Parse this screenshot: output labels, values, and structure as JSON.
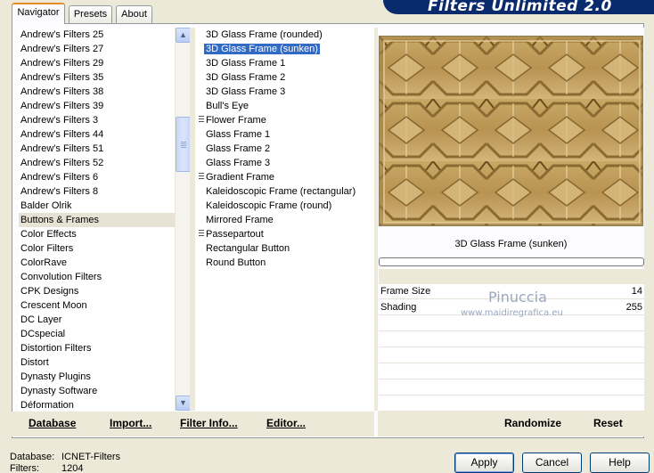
{
  "banner": {
    "title": "Filters Unlimited 2.0"
  },
  "tabs": [
    {
      "label": "Navigator",
      "active": true
    },
    {
      "label": "Presets",
      "active": false
    },
    {
      "label": "About",
      "active": false
    }
  ],
  "categories": [
    "Andrew's Filters 25",
    "Andrew's Filters 27",
    "Andrew's Filters 29",
    "Andrew's Filters 35",
    "Andrew's Filters 38",
    "Andrew's Filters 39",
    "Andrew's Filters 3",
    "Andrew's Filters 44",
    "Andrew's Filters 51",
    "Andrew's Filters 52",
    "Andrew's Filters 6",
    "Andrew's Filters 8",
    "Balder Olrik",
    "Buttons & Frames",
    "Color Effects",
    "Color Filters",
    "ColorRave",
    "Convolution Filters",
    "CPK Designs",
    "Crescent Moon",
    "DC Layer",
    "DCspecial",
    "Distortion Filters",
    "Distort",
    "Dynasty Plugins",
    "Dynasty Software",
    "Déformation"
  ],
  "selected_category": "Buttons & Frames",
  "filters": [
    {
      "label": "3D Glass Frame (rounded)",
      "grip": false
    },
    {
      "label": "3D Glass Frame (sunken)",
      "grip": false
    },
    {
      "label": "3D Glass Frame 1",
      "grip": false
    },
    {
      "label": "3D Glass Frame 2",
      "grip": false
    },
    {
      "label": "3D Glass Frame 3",
      "grip": false
    },
    {
      "label": "Bull's Eye",
      "grip": false
    },
    {
      "label": "Flower Frame",
      "grip": true
    },
    {
      "label": "Glass Frame 1",
      "grip": false
    },
    {
      "label": "Glass Frame 2",
      "grip": false
    },
    {
      "label": "Glass Frame 3",
      "grip": false
    },
    {
      "label": "Gradient Frame",
      "grip": true
    },
    {
      "label": "Kaleidoscopic Frame (rectangular)",
      "grip": false
    },
    {
      "label": "Kaleidoscopic Frame (round)",
      "grip": false
    },
    {
      "label": "Mirrored Frame",
      "grip": false
    },
    {
      "label": "Passepartout",
      "grip": true
    },
    {
      "label": "Rectangular Button",
      "grip": false
    },
    {
      "label": "Round Button",
      "grip": false
    }
  ],
  "selected_filter": "3D Glass Frame (sunken)",
  "preview": {
    "title": "3D Glass Frame (sunken)"
  },
  "params": [
    {
      "name": "Frame Size",
      "value": "14"
    },
    {
      "name": "Shading",
      "value": "255"
    }
  ],
  "watermark": {
    "name": "Pinuccia",
    "site": "www.maidiregrafica.eu"
  },
  "toolbar": {
    "database": "Database",
    "import": "Import...",
    "filter_info": "Filter Info...",
    "editor": "Editor...",
    "randomize": "Randomize",
    "reset": "Reset"
  },
  "status": {
    "database_label": "Database:",
    "database_value": "ICNET-Filters",
    "filters_label": "Filters:",
    "filters_value": "1204"
  },
  "buttons": {
    "apply": "Apply",
    "cancel": "Cancel",
    "help": "Help"
  },
  "colors": {
    "accent_tab": "#e68b2c",
    "selection": "#316ac5",
    "banner": "#0a2a6e"
  }
}
